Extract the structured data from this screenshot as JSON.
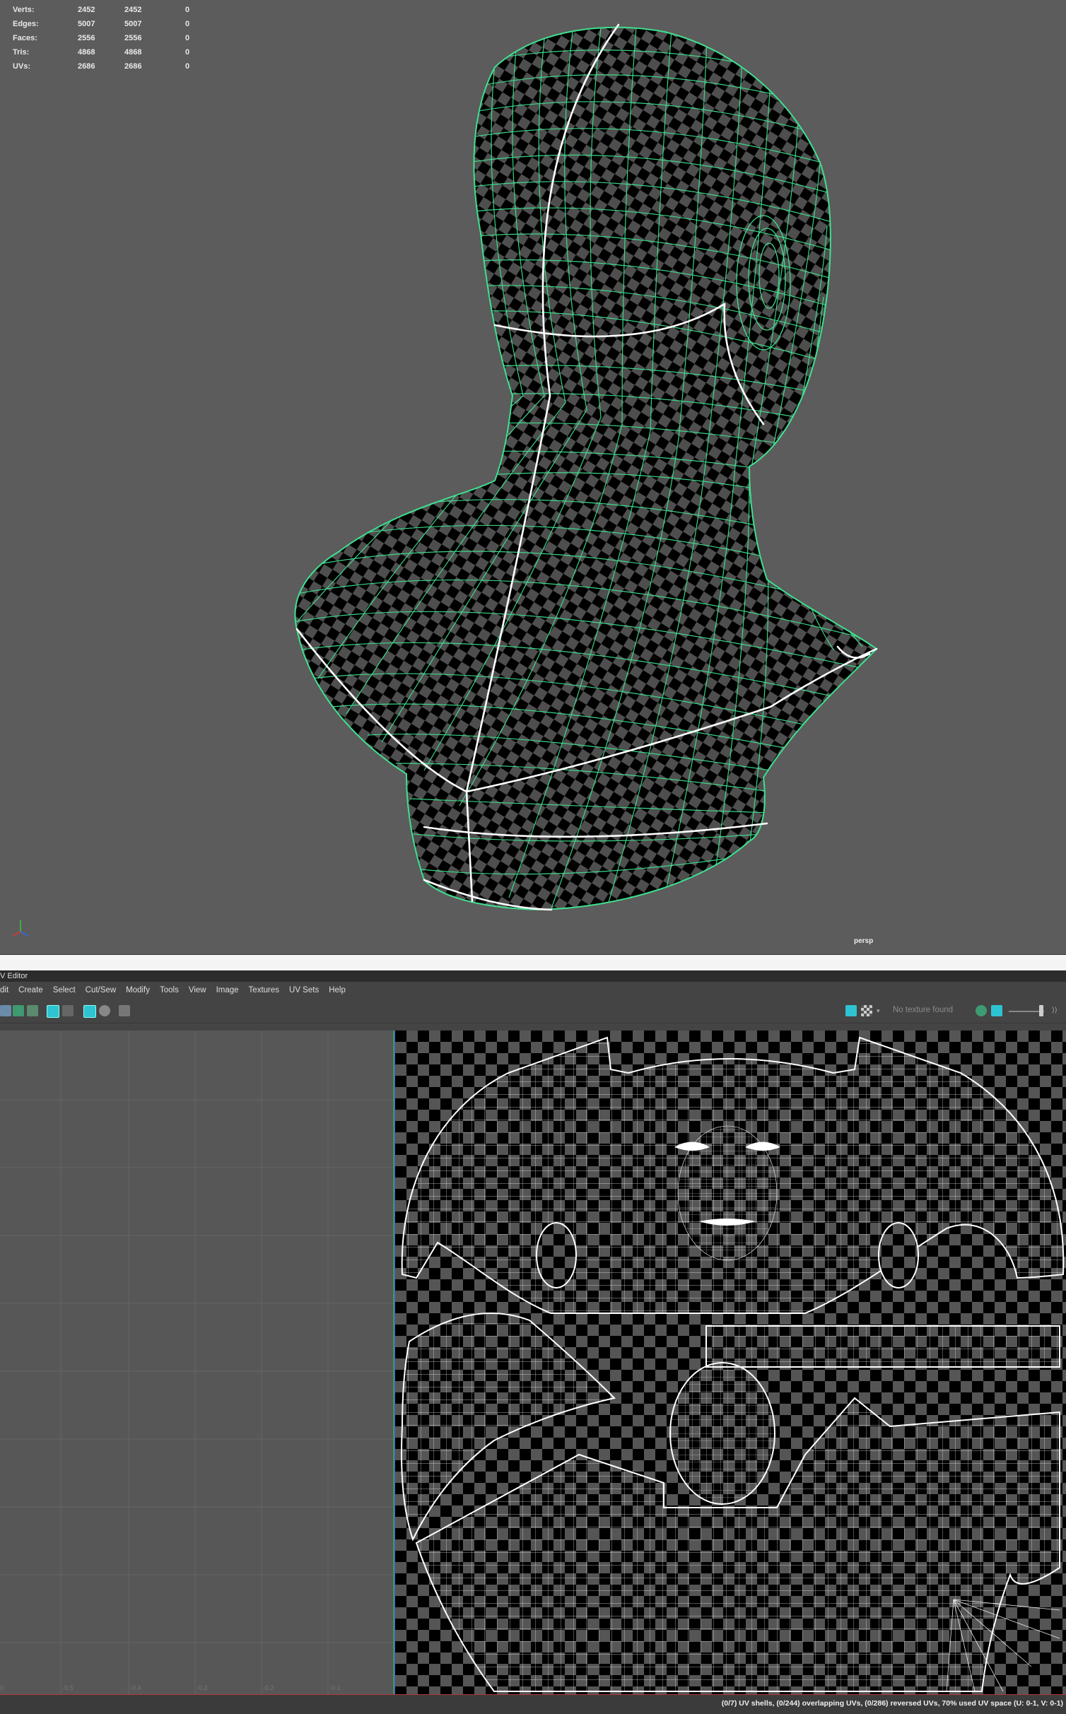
{
  "viewport": {
    "hud": [
      {
        "label": "Verts:",
        "v1": "2452",
        "v2": "2452",
        "v3": "0"
      },
      {
        "label": "Edges:",
        "v1": "5007",
        "v2": "5007",
        "v3": "0"
      },
      {
        "label": "Faces:",
        "v1": "2556",
        "v2": "2556",
        "v3": "0"
      },
      {
        "label": "Tris:",
        "v1": "4868",
        "v2": "4868",
        "v3": "0"
      },
      {
        "label": "UVs:",
        "v1": "2686",
        "v2": "2686",
        "v3": "0"
      }
    ],
    "camera_label": "persp",
    "wire_color": "#3fe08f",
    "seam_color": "#ffffff"
  },
  "uv_editor": {
    "title": "V Editor",
    "menus": [
      "dit",
      "Create",
      "Select",
      "Cut/Sew",
      "Modify",
      "Tools",
      "View",
      "Image",
      "Textures",
      "UV Sets",
      "Help"
    ],
    "no_texture_text": "No texture found",
    "grid_ticks": [
      "0",
      "-0.5",
      "-0.4",
      "-0.3",
      "-0.2",
      "-0.1"
    ],
    "status_text": "(0/7) UV shells, (0/244) overlapping UVs, (0/286) reversed UVs, 70% used UV space (U: 0-1, V: 0-1)",
    "accent": "#2ec3d1"
  }
}
